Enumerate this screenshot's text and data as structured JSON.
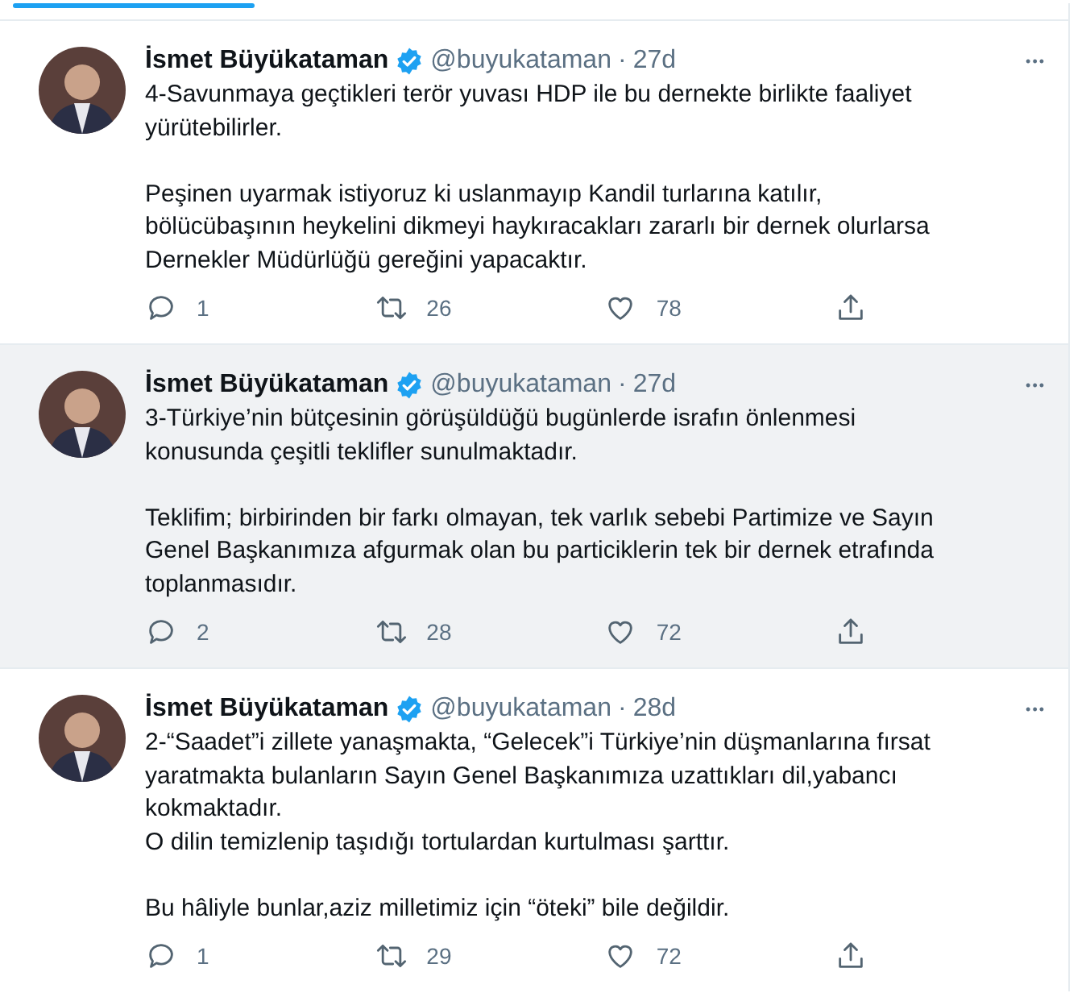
{
  "tab_indicator": {
    "selected": true
  },
  "tweets": [
    {
      "name": "İsmet Büyükataman",
      "verified": true,
      "handle": "@buyukataman",
      "separator": "·",
      "time": "27d",
      "more": "•••",
      "highlighted": false,
      "paragraphs": [
        {
          "lines": [
            "4-Savunmaya geçtikleri terör yuvası HDP ile bu dernekte birlikte faaliyet",
            "yürütebilirler."
          ]
        },
        {
          "lines": [
            "Peşinen uyarmak istiyoruz ki uslanmayıp Kandil turlarına katılır,",
            "bölücübaşının heykelini dikmeyi haykıracakları zararlı bir dernek olurlarsa",
            "Dernekler Müdürlüğü gereğini yapacaktır."
          ]
        }
      ],
      "replies": "1",
      "retweets": "26",
      "likes": "78"
    },
    {
      "name": "İsmet Büyükataman",
      "verified": true,
      "handle": "@buyukataman",
      "separator": "·",
      "time": "27d",
      "more": "•••",
      "highlighted": true,
      "paragraphs": [
        {
          "lines": [
            "3-Türkiye’nin bütçesinin görüşüldüğü bugünlerde israfın önlenmesi",
            "konusunda çeşitli teklifler sunulmaktadır."
          ]
        },
        {
          "lines": [
            "Teklifim; birbirinden bir farkı olmayan, tek varlık sebebi Partimize ve Sayın",
            "Genel Başkanımıza afgurmak olan bu particiklerin tek bir dernek etrafında",
            "toplanmasıdır."
          ]
        }
      ],
      "replies": "2",
      "retweets": "28",
      "likes": "72"
    },
    {
      "name": "İsmet Büyükataman",
      "verified": true,
      "handle": "@buyukataman",
      "separator": "·",
      "time": "28d",
      "more": "•••",
      "highlighted": false,
      "paragraphs": [
        {
          "lines": [
            "2-“Saadet”i zillete yanaşmakta, “Gelecek”i Türkiye’nin düşmanlarına fırsat",
            "yaratmakta bulanların Sayın Genel Başkanımıza uzattıkları dil,yabancı",
            "kokmaktadır.",
            "O dilin temizlenip taşıdığı tortulardan kurtulması şarttır."
          ]
        },
        {
          "lines": [
            "Bu hâliyle bunlar,aziz milletimiz için “öteki” bile değildir."
          ]
        }
      ],
      "replies": "1",
      "retweets": "29",
      "likes": "72"
    }
  ]
}
